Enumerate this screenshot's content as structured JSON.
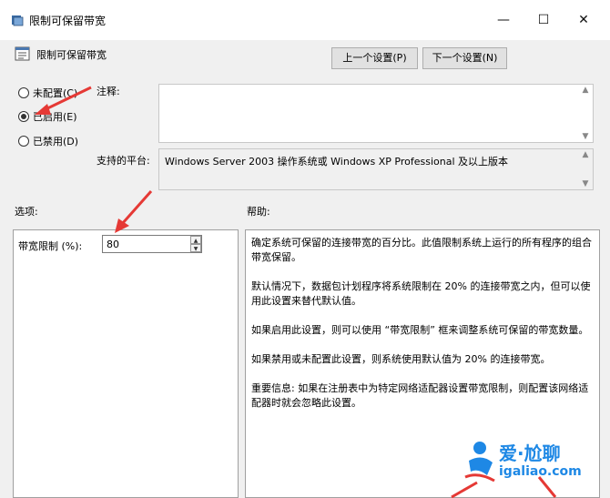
{
  "window": {
    "title": "限制可保留带宽",
    "minimize": "—",
    "maximize": "☐",
    "close": "✕"
  },
  "header": {
    "policy_name": "限制可保留带宽",
    "prev_button": "上一个设置(P)",
    "next_button": "下一个设置(N)"
  },
  "state": {
    "options": [
      {
        "label": "未配置(C)",
        "checked": false
      },
      {
        "label": "已启用(E)",
        "checked": true
      },
      {
        "label": "已禁用(D)",
        "checked": false
      }
    ]
  },
  "comment": {
    "label": "注释:",
    "value": ""
  },
  "platform": {
    "label": "支持的平台:",
    "value": "Windows Server 2003 操作系统或 Windows XP Professional 及以上版本"
  },
  "options_section": {
    "label": "选项:",
    "bandwidth_label": "带宽限制 (%):",
    "bandwidth_value": "80"
  },
  "help_section": {
    "label": "帮助:",
    "paragraphs": [
      "确定系统可保留的连接带宽的百分比。此值限制系统上运行的所有程序的组合带宽保留。",
      "默认情况下，数据包计划程序将系统限制在 20% 的连接带宽之内，但可以使用此设置来替代默认值。",
      "如果启用此设置，则可以使用 “带宽限制” 框来调整系统可保留的带宽数量。",
      "如果禁用或未配置此设置，则系统使用默认值为 20% 的连接带宽。",
      "重要信息: 如果在注册表中为特定网络适配器设置带宽限制，则配置该网络适配器时就会忽略此设置。"
    ]
  },
  "watermark": {
    "brand": "爱·尬聊",
    "url": "igaliao.com"
  },
  "colors": {
    "arrow": "#e53935",
    "watermark": "#1e88e5",
    "background": "#f0f0f0"
  }
}
